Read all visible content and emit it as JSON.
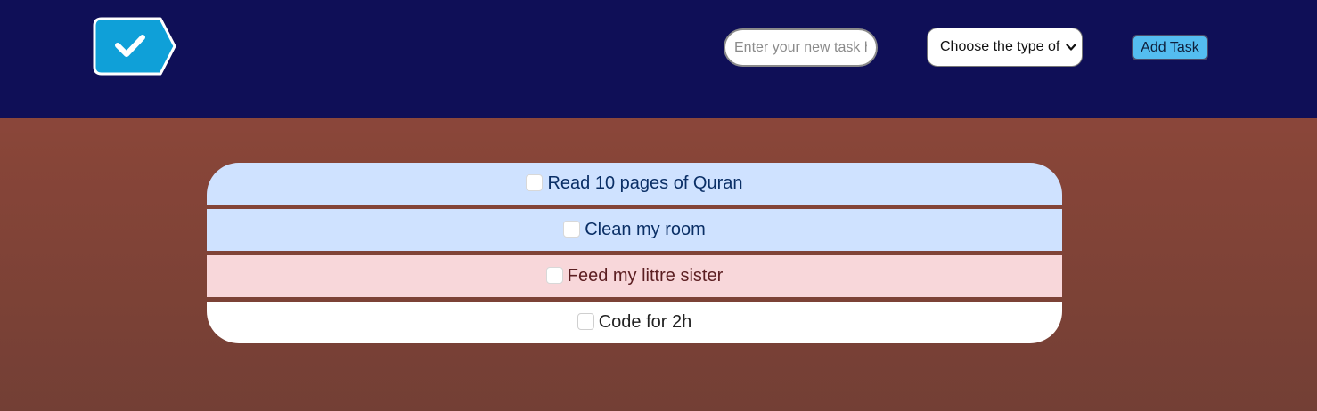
{
  "header": {
    "logo_icon": "checkmark-tag-icon",
    "task_input_placeholder": "Enter your new task here",
    "type_select_value": "Choose the type of task",
    "add_button_label": "Add Task"
  },
  "tasks": [
    {
      "label": "Read 10 pages of Quran",
      "checked": false,
      "color": "#cfe2ff"
    },
    {
      "label": "Clean my room",
      "checked": false,
      "color": "#cfe2ff"
    },
    {
      "label": "Feed my littre sister",
      "checked": false,
      "color": "#f8d7da"
    },
    {
      "label": "Code for 2h",
      "checked": false,
      "color": "#ffffff"
    }
  ],
  "colors": {
    "header_background": "#0f0f57",
    "page_background": "#8b4a3e",
    "logo_fill": "#0fa0d8",
    "button_background": "#54bdf0"
  }
}
